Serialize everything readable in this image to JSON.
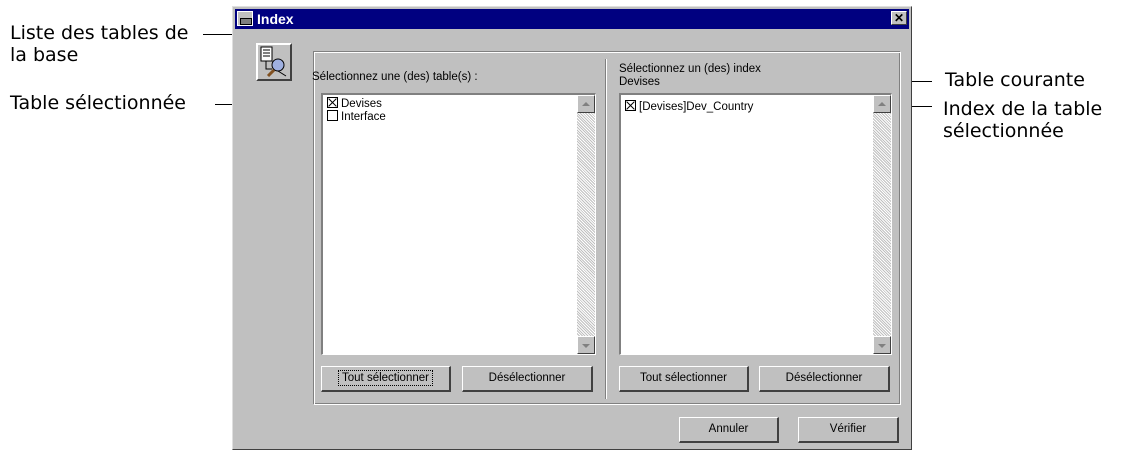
{
  "annotations": {
    "table_list": [
      "Liste des tables de",
      "la base"
    ],
    "selected_table": "Table sélectionnée",
    "current_table": "Table courante",
    "selected_table_index": [
      "Index de la table",
      "sélectionnée"
    ]
  },
  "window": {
    "title": "Index",
    "close_label": "✕",
    "icon": "index-tool-icon"
  },
  "left_panel": {
    "label": "Sélectionnez une (des) table(s) :",
    "items": [
      {
        "label": "Devises",
        "checked": true
      },
      {
        "label": "Interface",
        "checked": false
      }
    ],
    "select_all_label": "Tout sélectionner",
    "deselect_label": "Désélectionner"
  },
  "right_panel": {
    "label": "Sélectionnez un (des) index",
    "current_table": "Devises",
    "items": [
      {
        "label": "[Devises]Dev_Country",
        "checked": true
      }
    ],
    "select_all_label": "Tout sélectionner",
    "deselect_label": "Désélectionner"
  },
  "footer": {
    "cancel_label": "Annuler",
    "verify_label": "Vérifier"
  }
}
